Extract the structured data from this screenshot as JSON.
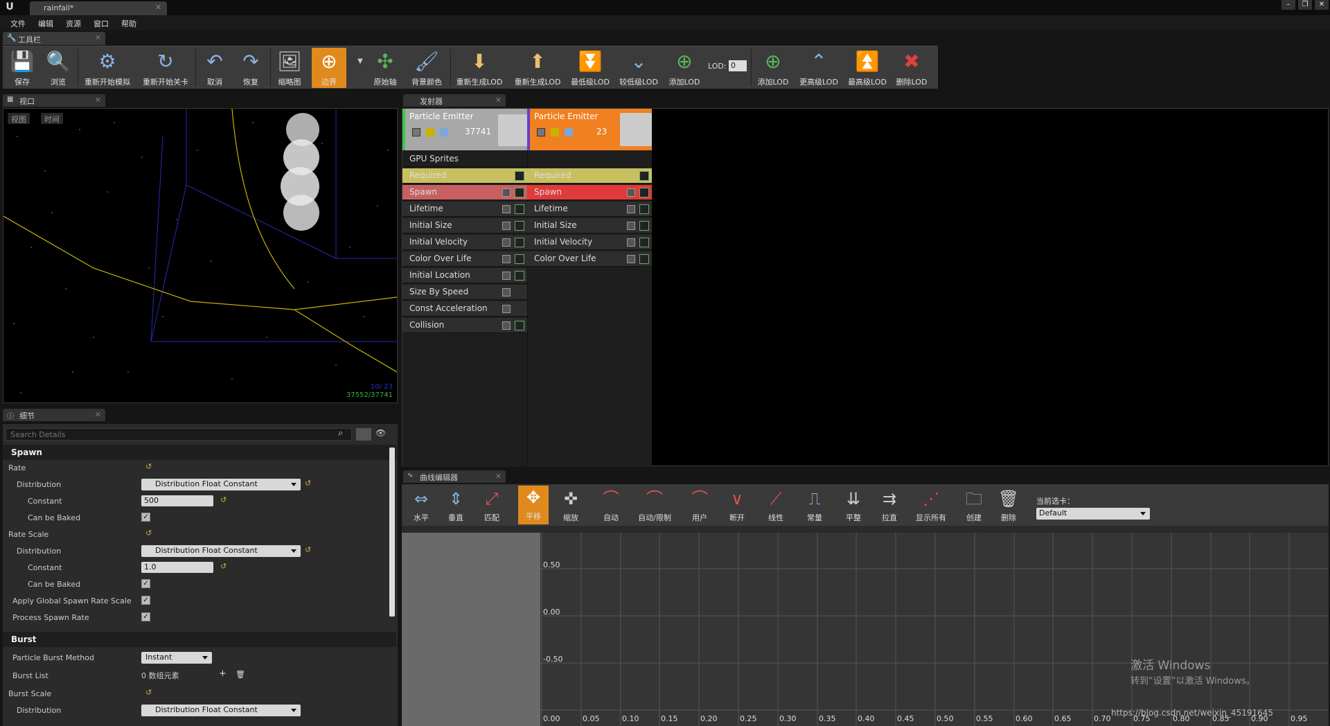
{
  "title_bar": {
    "doc_tab": "rainfall*"
  },
  "menu": [
    "文件",
    "编辑",
    "资源",
    "窗口",
    "帮助"
  ],
  "toolbar": {
    "tab": "工具栏",
    "buttons": [
      {
        "label": "保存",
        "icon": "save-icon"
      },
      {
        "label": "浏览",
        "icon": "browse-icon"
      },
      {
        "label": "重新开始模拟",
        "icon": "restart-sim-icon"
      },
      {
        "label": "重新开始关卡",
        "icon": "restart-level-icon"
      },
      {
        "label": "取消",
        "icon": "undo-icon"
      },
      {
        "label": "恢复",
        "icon": "redo-icon"
      },
      {
        "label": "缩略图",
        "icon": "thumbnail-icon"
      },
      {
        "label": "边界",
        "icon": "bounds-icon"
      },
      {
        "label": "原始轴",
        "icon": "axis-icon"
      },
      {
        "label": "背景颜色",
        "icon": "bg-color-icon"
      },
      {
        "label": "重新生成LOD",
        "icon": "regen-lod-icon"
      },
      {
        "label": "重新生成LOD",
        "icon": "regen-lod2-icon"
      },
      {
        "label": "最低级LOD",
        "icon": "lowest-lod-icon"
      },
      {
        "label": "较低级LOD",
        "icon": "lower-lod-icon"
      },
      {
        "label": "添加LOD",
        "icon": "add-lod-icon"
      },
      {
        "label": "添加LOD",
        "icon": "add-lod2-icon"
      },
      {
        "label": "更高级LOD",
        "icon": "higher-lod-icon"
      },
      {
        "label": "最高级LOD",
        "icon": "highest-lod-icon"
      },
      {
        "label": "删除LOD",
        "icon": "delete-lod-icon"
      }
    ],
    "lod_label": "LOD:",
    "lod_value": "0"
  },
  "viewport": {
    "tab": "视口",
    "btn_view": "视图",
    "btn_time": "时间",
    "stats1": "10/ 23",
    "stats2": "37552/37741"
  },
  "emitters": {
    "tab": "发射器",
    "columns": [
      {
        "name": "Particle Emitter",
        "count": "37741",
        "type": "GPU Sprites",
        "modules": [
          "Required",
          "Spawn",
          "Lifetime",
          "Initial Size",
          "Initial Velocity",
          "Color Over Life",
          "Initial Location",
          "Size By Speed",
          "Const Acceleration",
          "Collision"
        ]
      },
      {
        "name": "Particle Emitter",
        "count": "23",
        "type": "",
        "modules": [
          "Required",
          "Spawn",
          "Lifetime",
          "Initial Size",
          "Initial Velocity",
          "Color Over Life"
        ]
      }
    ]
  },
  "details": {
    "tab": "细节",
    "search_placeholder": "Search Details",
    "cat_spawn": "Spawn",
    "rate": "Rate",
    "distribution": "Distribution",
    "dist_value": "Distribution Float Constant",
    "constant": "Constant",
    "constant_value": "500",
    "can_be_baked": "Can be Baked",
    "rate_scale": "Rate Scale",
    "constant2_value": "1.0",
    "apply_global": "Apply Global Spawn Rate Scale",
    "process_spawn": "Process Spawn Rate",
    "cat_burst": "Burst",
    "burst_method": "Particle Burst Method",
    "burst_method_value": "Instant",
    "burst_list": "Burst List",
    "burst_list_value": "0 数组元素",
    "burst_scale": "Burst Scale"
  },
  "curve_editor": {
    "tab": "曲线编辑器",
    "buttons": [
      "水平",
      "垂直",
      "匹配",
      "平移",
      "缩放",
      "自动",
      "自动/限制",
      "用户",
      "断开",
      "线性",
      "常量",
      "平整",
      "拉直",
      "显示所有",
      "创建",
      "删除"
    ],
    "current_tab_label": "当前选卡：",
    "current_tab_value": "Default",
    "y_labels": [
      "0.50",
      "0.00",
      "-0.50"
    ],
    "x_labels": [
      "0.00",
      "0.05",
      "0.10",
      "0.15",
      "0.20",
      "0.25",
      "0.30",
      "0.35",
      "0.40",
      "0.45",
      "0.50",
      "0.55",
      "0.60",
      "0.65",
      "0.70",
      "0.75",
      "0.80",
      "0.85",
      "0.90",
      "0.95"
    ]
  },
  "watermark": {
    "line1": "激活 Windows",
    "line2": "转到“设置”以激活 Windows。",
    "url": "https://blog.csdn.net/weixin_45191645"
  }
}
